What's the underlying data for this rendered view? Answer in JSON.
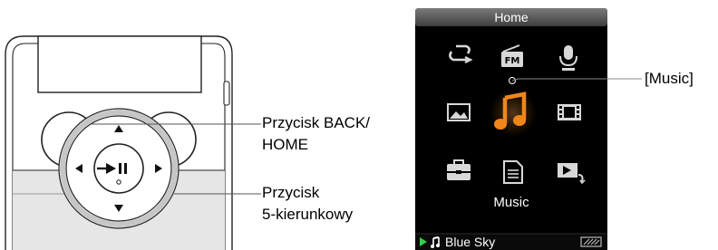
{
  "labels": {
    "back_home_line1": "Przycisk BACK/",
    "back_home_line2": "HOME",
    "five_way_line1": "Przycisk",
    "five_way_line2": "5-kierunkowy",
    "music_callout": "[Music]"
  },
  "screen": {
    "title": "Home",
    "selected_label": "Music",
    "now_playing": "Blue Sky"
  },
  "icons": [
    "repeat-icon",
    "fm-radio-icon",
    "microphone-icon",
    "photo-icon",
    "music-note-icon",
    "video-icon",
    "settings-toolbox-icon",
    "podcast-document-icon",
    "now-playing-icon"
  ],
  "colors": {
    "screen_bg": "#000000",
    "title_bar": "#5d5d5d",
    "icon_gray": "#d8d8d8",
    "selected_orange": "#f0861a",
    "status_green": "#2fd24a"
  }
}
